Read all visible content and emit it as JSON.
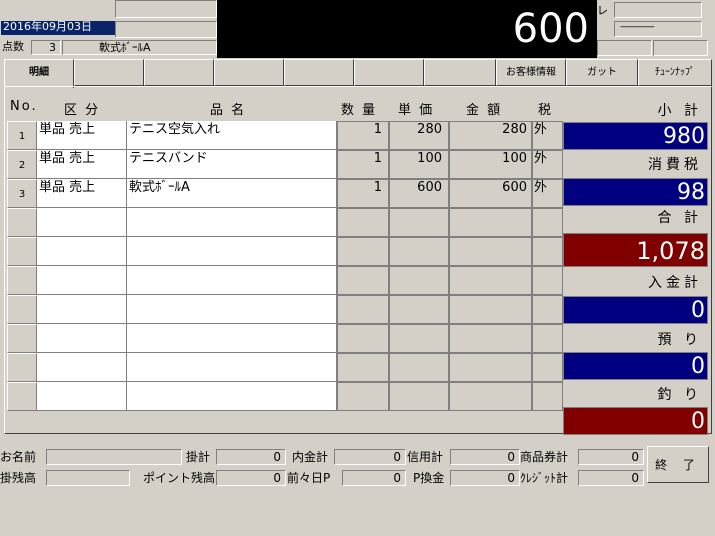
{
  "header": {
    "date": "2016年09月03日",
    "count_label": "点数",
    "count": "3",
    "current_item": "軟式ﾎﾞｰﾙA",
    "display_amount": "600",
    "display_unit": "レ",
    "dashes": "---------------"
  },
  "tabs": [
    {
      "label": "明細"
    },
    {
      "label": ""
    },
    {
      "label": ""
    },
    {
      "label": ""
    },
    {
      "label": ""
    },
    {
      "label": ""
    },
    {
      "label": ""
    },
    {
      "label": "お客様情報"
    },
    {
      "label": "ガット"
    },
    {
      "label": "ﾁｭｰﾝﾅｯﾌﾟ"
    }
  ],
  "columns": {
    "no": "No.",
    "type": "区 分",
    "name": "品 名",
    "qty": "数 量",
    "price": "単 価",
    "amount": "金 額",
    "tax": "税"
  },
  "rows": [
    {
      "no": "1",
      "type": "単品 売上",
      "name": "テニス空気入れ",
      "qty": "1",
      "price": "280",
      "amount": "280",
      "tax": "外"
    },
    {
      "no": "2",
      "type": "単品 売上",
      "name": "テニスバンド",
      "qty": "1",
      "price": "100",
      "amount": "100",
      "tax": "外"
    },
    {
      "no": "3",
      "type": "単品 売上",
      "name": "軟式ﾎﾞｰﾙA",
      "qty": "1",
      "price": "600",
      "amount": "600",
      "tax": "外"
    },
    {
      "no": "",
      "type": "",
      "name": "",
      "qty": "",
      "price": "",
      "amount": "",
      "tax": ""
    },
    {
      "no": "",
      "type": "",
      "name": "",
      "qty": "",
      "price": "",
      "amount": "",
      "tax": ""
    },
    {
      "no": "",
      "type": "",
      "name": "",
      "qty": "",
      "price": "",
      "amount": "",
      "tax": ""
    },
    {
      "no": "",
      "type": "",
      "name": "",
      "qty": "",
      "price": "",
      "amount": "",
      "tax": ""
    },
    {
      "no": "",
      "type": "",
      "name": "",
      "qty": "",
      "price": "",
      "amount": "",
      "tax": ""
    },
    {
      "no": "",
      "type": "",
      "name": "",
      "qty": "",
      "price": "",
      "amount": "",
      "tax": ""
    },
    {
      "no": "",
      "type": "",
      "name": "",
      "qty": "",
      "price": "",
      "amount": "",
      "tax": ""
    }
  ],
  "totals": {
    "subtotal_label": "小 計",
    "subtotal": "980",
    "tax_label": "消費税",
    "tax": "98",
    "total_label": "合 計",
    "total": "1,078",
    "paid_label": "入金計",
    "paid": "0",
    "deposit_label": "預 り",
    "deposit": "0",
    "change_label": "釣 り",
    "change": "0"
  },
  "footer": {
    "name_label": "お名前",
    "name": "",
    "kake_label": "掛計",
    "kake": "0",
    "uchikin_label": "内金計",
    "uchikin": "0",
    "credit_label": "信用計",
    "credit": "0",
    "giftcert_label": "商品券計",
    "giftcert": "0",
    "kakezan_label": "掛残高",
    "kakezan": "",
    "point_label": "ポイント残高",
    "point": "0",
    "prevday_label": "前々日P",
    "prevday": "0",
    "pconv_label": "P換金",
    "pconv": "0",
    "card_label": "ｸﾚｼﾞｯﾄ計",
    "card": "0",
    "end_label": "終 了"
  },
  "colors": {
    "blue_panel": "#000080",
    "red_panel": "#800000",
    "date_highlight": "#0a246a"
  }
}
